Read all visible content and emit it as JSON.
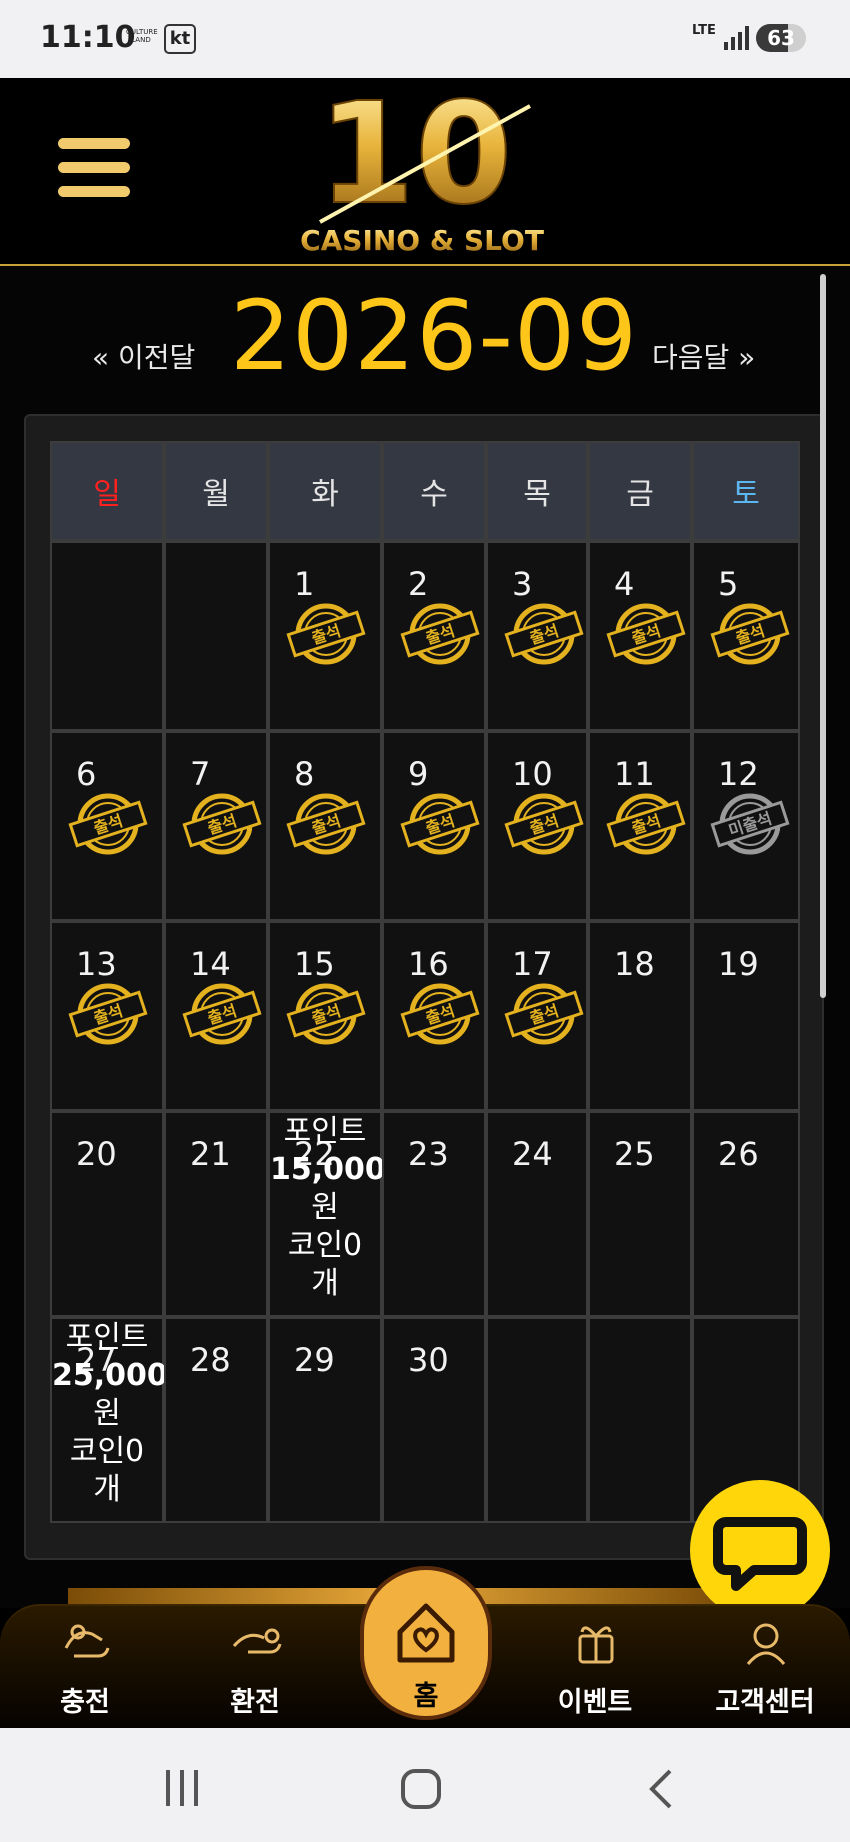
{
  "status_bar": {
    "time": "11:10",
    "carrier_logo": "CULTURE LAND",
    "carrier": "kt",
    "network": "LTE",
    "battery": "63"
  },
  "header": {
    "logo_number": "10",
    "logo_text": "CASINO & SLOT"
  },
  "calendar": {
    "prev_label": "« 이전달",
    "next_label": "다음달 »",
    "month": "2026-09",
    "weekdays": [
      "일",
      "월",
      "화",
      "수",
      "목",
      "금",
      "토"
    ],
    "weeks": [
      [
        "",
        "",
        "1",
        "2",
        "3",
        "4",
        "5"
      ],
      [
        "6",
        "7",
        "8",
        "9",
        "10",
        "11",
        "12"
      ],
      [
        "13",
        "14",
        "15",
        "16",
        "17",
        "18",
        "19"
      ],
      [
        "20",
        "21",
        "22",
        "23",
        "24",
        "25",
        "26"
      ],
      [
        "27",
        "28",
        "29",
        "30",
        "",
        "",
        ""
      ]
    ],
    "stamps": {
      "attended_label": "출석",
      "missed_label": "미출석"
    },
    "rewards": {
      "day22": {
        "line1": "포인트",
        "line2": "15,000",
        "line3": "원",
        "line4": "코인0",
        "line5": "개"
      },
      "day27": {
        "line1": "포인트",
        "line2": "25,000",
        "line3": "원",
        "line4": "코인0",
        "line5": "개"
      }
    }
  },
  "bottom_nav": {
    "charge": "충전",
    "exchange": "환전",
    "home": "홈",
    "event": "이벤트",
    "support": "고객센터"
  },
  "colors": {
    "accent": "#ffc61a",
    "sunday": "#ff2020",
    "saturday": "#5ab7f0",
    "chat": "#ffd60a",
    "home": "#f2b13f"
  }
}
